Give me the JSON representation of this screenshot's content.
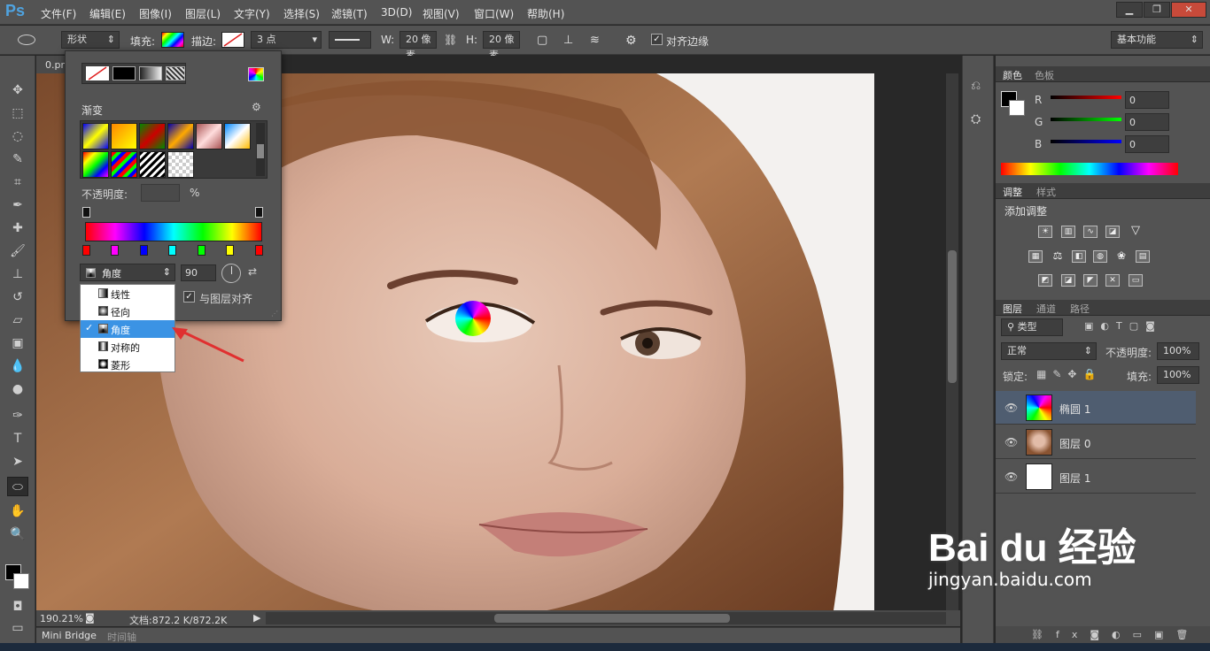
{
  "app": {
    "logo": "Ps"
  },
  "menu": [
    "文件(F)",
    "编辑(E)",
    "图像(I)",
    "图层(L)",
    "文字(Y)",
    "选择(S)",
    "滤镜(T)",
    "3D(D)",
    "视图(V)",
    "窗口(W)",
    "帮助(H)"
  ],
  "window_controls": [
    "▁",
    "❐",
    "✕"
  ],
  "options": {
    "mode": "形状",
    "fill_label": "填充:",
    "stroke_label": "描边:",
    "stroke_width": "3 点",
    "w_label": "W:",
    "w_value": "20 像素",
    "h_label": "H:",
    "h_value": "20 像素",
    "align_edges": "对齐边缘",
    "workspace": "基本功能"
  },
  "document": {
    "tab": "0.pr",
    "zoom": "190.21%",
    "doc_info": "文档:872.2 K/872.2K"
  },
  "bottom_tabs": [
    "Mini Bridge",
    "时间轴"
  ],
  "fill_popup": {
    "section_label": "渐变",
    "opacity_label": "不透明度:",
    "opacity_unit": "%",
    "gradient_type": "角度",
    "angle": "90",
    "align_layer": "与图层对齐",
    "dropdown_items": [
      {
        "label": "线性",
        "selected": false
      },
      {
        "label": "径向",
        "selected": false
      },
      {
        "label": "角度",
        "selected": true
      },
      {
        "label": "对称的",
        "selected": false
      },
      {
        "label": "菱形",
        "selected": false
      }
    ],
    "checkmark": "✓"
  },
  "color_panel": {
    "tabs": [
      "颜色",
      "色板"
    ],
    "channels": [
      {
        "label": "R",
        "value": "0",
        "color": "#d01010"
      },
      {
        "label": "G",
        "value": "0",
        "color": "#10c010"
      },
      {
        "label": "B",
        "value": "0",
        "color": "#1020d0"
      }
    ]
  },
  "adjust_panel": {
    "tabs": [
      "调整",
      "样式"
    ],
    "title": "添加调整"
  },
  "layers_panel": {
    "tabs": [
      "图层",
      "通道",
      "路径"
    ],
    "filter_kind": "类型",
    "blend_mode": "正常",
    "opacity_label": "不透明度:",
    "opacity_value": "100%",
    "lock_label": "锁定:",
    "fill_label": "填充:",
    "fill_value": "100%",
    "layers": [
      {
        "name": "椭圆 1",
        "selected": true
      },
      {
        "name": "图层 0",
        "selected": false
      },
      {
        "name": "图层 1",
        "selected": false
      }
    ]
  },
  "watermark": {
    "brand": "Bai du 经验",
    "url": "jingyan.baidu.com"
  },
  "colors": {
    "accent": "#3b93e4",
    "panel_bg": "#535353",
    "selected_layer": "#4f5d70"
  }
}
